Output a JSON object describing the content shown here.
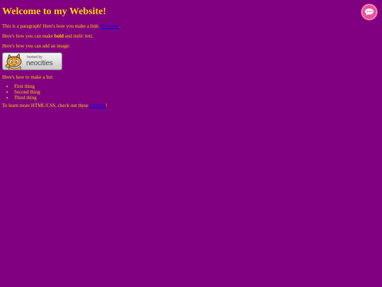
{
  "heading": "Welcome to my Website!",
  "intro": {
    "before": "This is a paragraph! Here's how you make a link: ",
    "link_text": "Neocities",
    "after": "."
  },
  "formatting": {
    "before": "Here's how you can make ",
    "bold": "bold",
    "middle": " and ",
    "italic": "italic",
    "after": " text."
  },
  "image_text": "Here's how you can add an image:",
  "badge": {
    "small_text": "hosted by",
    "big_text": "neocities"
  },
  "list_intro": "Here's how to make a list:",
  "list_items": [
    "First thing",
    "Second thing",
    "Third thing"
  ],
  "outro": {
    "before": "To learn more HTML/CSS, check out these ",
    "link_text": "tutorials",
    "after": "!"
  },
  "chat_button": {
    "icon": "chat-bubble-icon",
    "color": "#e7549a"
  },
  "colors": {
    "background": "#800080",
    "text": "#ffd700",
    "link": "#0000ee"
  }
}
